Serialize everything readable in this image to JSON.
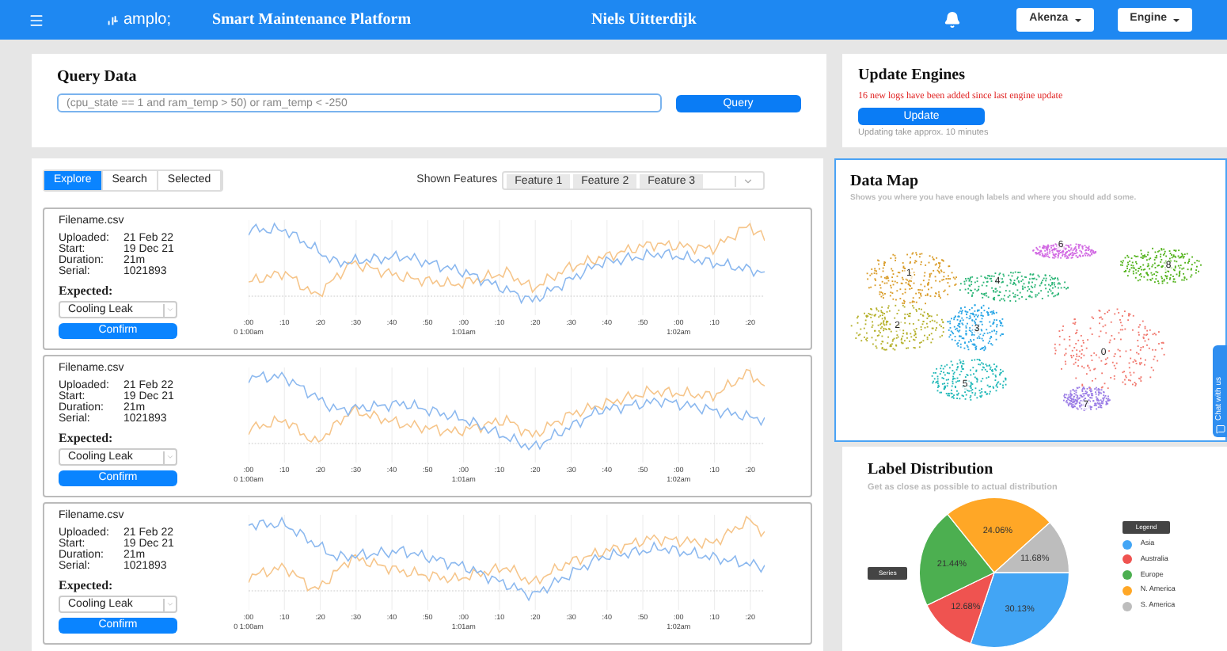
{
  "header": {
    "logo": "amplo;",
    "title": "Smart Maintenance Platform",
    "user": "Niels Uitterdijk",
    "dropdowns": [
      {
        "label": "Akenza"
      },
      {
        "label": "Engine"
      }
    ]
  },
  "query": {
    "title": "Query Data",
    "placeholder": "(cpu_state == 1 and ram_temp > 50) or ram_temp < -250",
    "button": "Query"
  },
  "update": {
    "title": "Update Engines",
    "notice": "16 new logs have been added since last engine update",
    "button": "Update",
    "note": "Updating take approx. 10 minutes"
  },
  "tabs": [
    {
      "label": "Explore",
      "selected": true
    },
    {
      "label": "Search",
      "selected": false
    },
    {
      "label": "Selected",
      "selected": false
    }
  ],
  "features": {
    "label": "Shown Features",
    "chips": [
      "Feature 1",
      "Feature 2",
      "Feature 3"
    ]
  },
  "files": [
    {
      "name": "Filename.csv",
      "fields": [
        {
          "label": "Uploaded:",
          "value": "21 Feb 22"
        },
        {
          "label": "Start:",
          "value": "19 Dec 21"
        },
        {
          "label": "Duration:",
          "value": "21m"
        },
        {
          "label": "Serial:",
          "value": "1021893"
        }
      ],
      "expected_label": "Expected:",
      "expected": "Cooling Leak",
      "button": "Confirm",
      "x_ticks": [
        ":00",
        ":10",
        ":20",
        ":30",
        ":40",
        ":50",
        ":00",
        ":10",
        ":20",
        ":30",
        ":40",
        ":50",
        ":00",
        ":10",
        ":20"
      ],
      "x_times": [
        "0 1:00am",
        "1:01am",
        "1:02am"
      ]
    },
    {
      "name": "Filename.csv",
      "fields": [
        {
          "label": "Uploaded:",
          "value": "21 Feb 22"
        },
        {
          "label": "Start:",
          "value": "19 Dec 21"
        },
        {
          "label": "Duration:",
          "value": "21m"
        },
        {
          "label": "Serial:",
          "value": "1021893"
        }
      ],
      "expected_label": "Expected:",
      "expected": "Cooling Leak",
      "button": "Confirm",
      "x_ticks": [
        ":00",
        ":10",
        ":20",
        ":30",
        ":40",
        ":50",
        ":00",
        ":10",
        ":20",
        ":30",
        ":40",
        ":50",
        ":00",
        ":10",
        ":20"
      ],
      "x_times": [
        "0 1:00am",
        "1:01am",
        "1:02am"
      ]
    },
    {
      "name": "Filename.csv",
      "fields": [
        {
          "label": "Uploaded:",
          "value": "21 Feb 22"
        },
        {
          "label": "Start:",
          "value": "19 Dec 21"
        },
        {
          "label": "Duration:",
          "value": "21m"
        },
        {
          "label": "Serial:",
          "value": "1021893"
        }
      ],
      "expected_label": "Expected:",
      "expected": "Cooling Leak",
      "button": "Confirm",
      "x_ticks": [
        ":00",
        ":10",
        ":20",
        ":30",
        ":40",
        ":50",
        ":00",
        ":10",
        ":20",
        ":30",
        ":40",
        ":50",
        ":00",
        ":10",
        ":20"
      ],
      "x_times": [
        "0 1:00am",
        "1:01am",
        "1:02am"
      ]
    }
  ],
  "data_map": {
    "title": "Data Map",
    "subtitle": "Shows you where you have enough labels and where you should add some.",
    "cluster_labels": [
      "0",
      "1",
      "2",
      "3",
      "4",
      "5",
      "6",
      "7",
      "8"
    ]
  },
  "label_distribution": {
    "title": "Label Distribution",
    "subtitle": "Get as close as possible to actual distribution",
    "legend_title": "Legend",
    "chart_data": {
      "type": "pie",
      "categories": [
        "Asia",
        "Australia",
        "Europe",
        "N. America",
        "S. America"
      ],
      "series": [
        {
          "name": "Series",
          "values": [
            30.13,
            12.68,
            21.44,
            24.06,
            11.68
          ]
        }
      ],
      "colors": [
        "#42a5f5",
        "#ef5350",
        "#4caf50",
        "#ffa726",
        "#bdbdbd"
      ],
      "value_labels": [
        "30.13%",
        "12.68%",
        "21.44%",
        "24.06%",
        "11.68%"
      ]
    }
  },
  "chat_tab": {
    "label": "Chat with us"
  }
}
